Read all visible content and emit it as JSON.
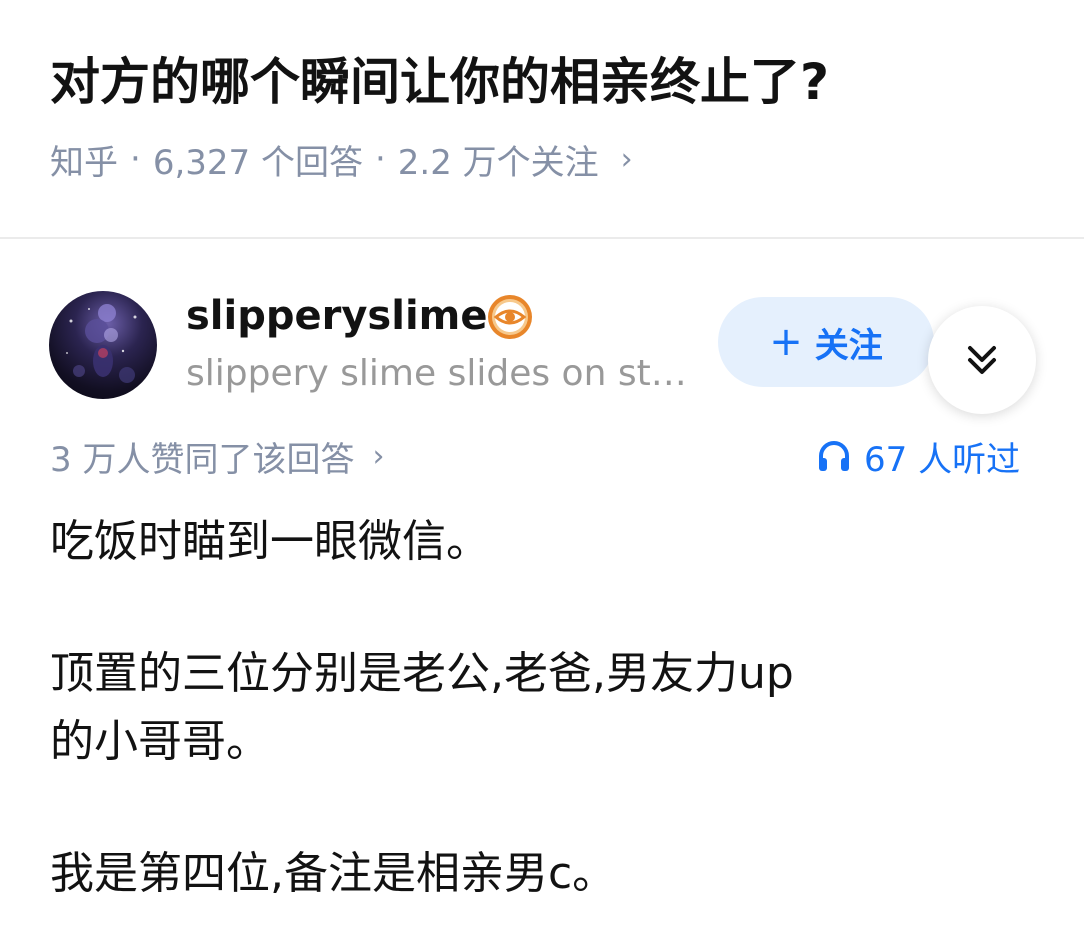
{
  "question": {
    "title": "对方的哪个瞬间让你的相亲终止了?",
    "source": "知乎",
    "separator": "·",
    "answer_count": "6,327 个回答",
    "follow_count": "2.2 万个关注",
    "chevron": "›"
  },
  "author": {
    "name": "slipperyslime",
    "bio": "slippery slime slides on str...",
    "badge_icon": "eye-badge-icon",
    "follow_plus": "+",
    "follow_label": "关注",
    "collapse_icon": "double-chevron-down-icon"
  },
  "stats": {
    "upvotes": "3 万人赞同了该回答",
    "chevron": "›",
    "listen_icon": "headphones-icon",
    "listens": "67 人听过"
  },
  "answer": {
    "p1": "吃饭时瞄到一眼微信。",
    "p2_line1": "顶置的三位分别是老公,老爸,男友力up",
    "p2_line2": "的小哥哥。",
    "p3": "我是第四位,备注是相亲男c。"
  },
  "colors": {
    "brand_blue": "#1772f6",
    "follow_bg": "#e5f0fd",
    "meta_gray": "#8590a6",
    "bio_gray": "#999999",
    "badge_orange": "#e8862a"
  }
}
